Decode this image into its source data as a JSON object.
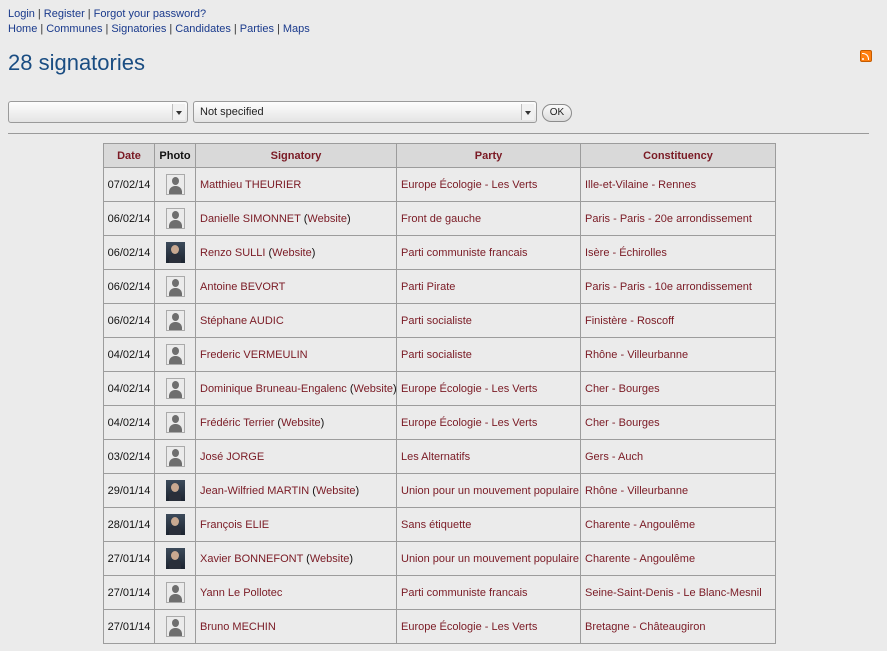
{
  "nav": {
    "row1": [
      "Login",
      "Register",
      "Forgot your password?"
    ],
    "row2": [
      "Home",
      "Communes",
      "Signatories",
      "Candidates",
      "Parties",
      "Maps"
    ]
  },
  "page_title": "28 signatories",
  "filters": {
    "select1_value": "",
    "select2_value": "Not specified",
    "ok_label": "OK"
  },
  "table": {
    "headers": [
      "Date",
      "Photo",
      "Signatory",
      "Party",
      "Constituency"
    ],
    "website_label": "Website",
    "rows": [
      {
        "date": "07/02/14",
        "photo": "generic",
        "name": "Matthieu THEURIER",
        "website": false,
        "party": "Europe Écologie - Les Verts",
        "constituency": "Ille-et-Vilaine - Rennes"
      },
      {
        "date": "06/02/14",
        "photo": "generic",
        "name": "Danielle SIMONNET",
        "website": true,
        "party": "Front de gauche",
        "constituency": "Paris - Paris - 20e arrondissement"
      },
      {
        "date": "06/02/14",
        "photo": "real",
        "name": "Renzo SULLI",
        "website": true,
        "party": "Parti communiste francais",
        "constituency": "Isère - Échirolles"
      },
      {
        "date": "06/02/14",
        "photo": "generic",
        "name": "Antoine BEVORT",
        "website": false,
        "party": "Parti Pirate",
        "constituency": "Paris - Paris - 10e arrondissement"
      },
      {
        "date": "06/02/14",
        "photo": "generic",
        "name": "Stéphane AUDIC",
        "website": false,
        "party": "Parti socialiste",
        "constituency": "Finistère - Roscoff"
      },
      {
        "date": "04/02/14",
        "photo": "generic",
        "name": "Frederic VERMEULIN",
        "website": false,
        "party": "Parti socialiste",
        "constituency": "Rhône - Villeurbanne"
      },
      {
        "date": "04/02/14",
        "photo": "generic",
        "name": "Dominique Bruneau-Engalenc",
        "website": true,
        "party": "Europe Écologie - Les Verts",
        "constituency": "Cher - Bourges"
      },
      {
        "date": "04/02/14",
        "photo": "generic",
        "name": "Frédéric Terrier",
        "website": true,
        "party": "Europe Écologie - Les Verts",
        "constituency": "Cher - Bourges"
      },
      {
        "date": "03/02/14",
        "photo": "generic",
        "name": "José JORGE",
        "website": false,
        "party": "Les Alternatifs",
        "constituency": "Gers - Auch"
      },
      {
        "date": "29/01/14",
        "photo": "real",
        "name": "Jean-Wilfried MARTIN",
        "website": true,
        "party": "Union pour un mouvement populaire",
        "constituency": "Rhône - Villeurbanne"
      },
      {
        "date": "28/01/14",
        "photo": "real",
        "name": "François ELIE",
        "website": false,
        "party": "Sans étiquette",
        "constituency": "Charente - Angoulême"
      },
      {
        "date": "27/01/14",
        "photo": "real",
        "name": "Xavier BONNEFONT",
        "website": true,
        "party": "Union pour un mouvement populaire",
        "constituency": "Charente - Angoulême"
      },
      {
        "date": "27/01/14",
        "photo": "generic",
        "name": "Yann Le Pollotec",
        "website": false,
        "party": "Parti communiste francais",
        "constituency": "Seine-Saint-Denis - Le Blanc-Mesnil"
      },
      {
        "date": "27/01/14",
        "photo": "generic",
        "name": "Bruno MECHIN",
        "website": false,
        "party": "Europe Écologie - Les Verts",
        "constituency": "Bretagne - Châteaugiron"
      }
    ]
  }
}
